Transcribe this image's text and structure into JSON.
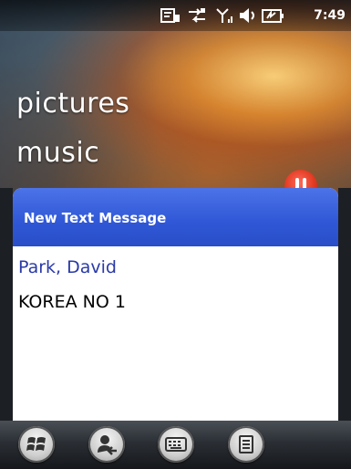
{
  "status_bar": {
    "time": "7:49",
    "icons": [
      "message-icon",
      "connectivity-icon",
      "signal-icon",
      "volume-icon",
      "battery-icon"
    ]
  },
  "home": {
    "items": [
      "pictures",
      "music"
    ]
  },
  "dialog": {
    "title": "New Text Message",
    "sender": "Park, David",
    "body": "KOREA NO 1"
  },
  "bottom_bar": {
    "buttons": [
      "start-icon",
      "contacts-icon",
      "keyboard-icon",
      "menu-icon"
    ]
  },
  "colors": {
    "dialog_header": "#2f57d6",
    "sender_text": "#2a3aa8",
    "badge": "#e23a22"
  }
}
